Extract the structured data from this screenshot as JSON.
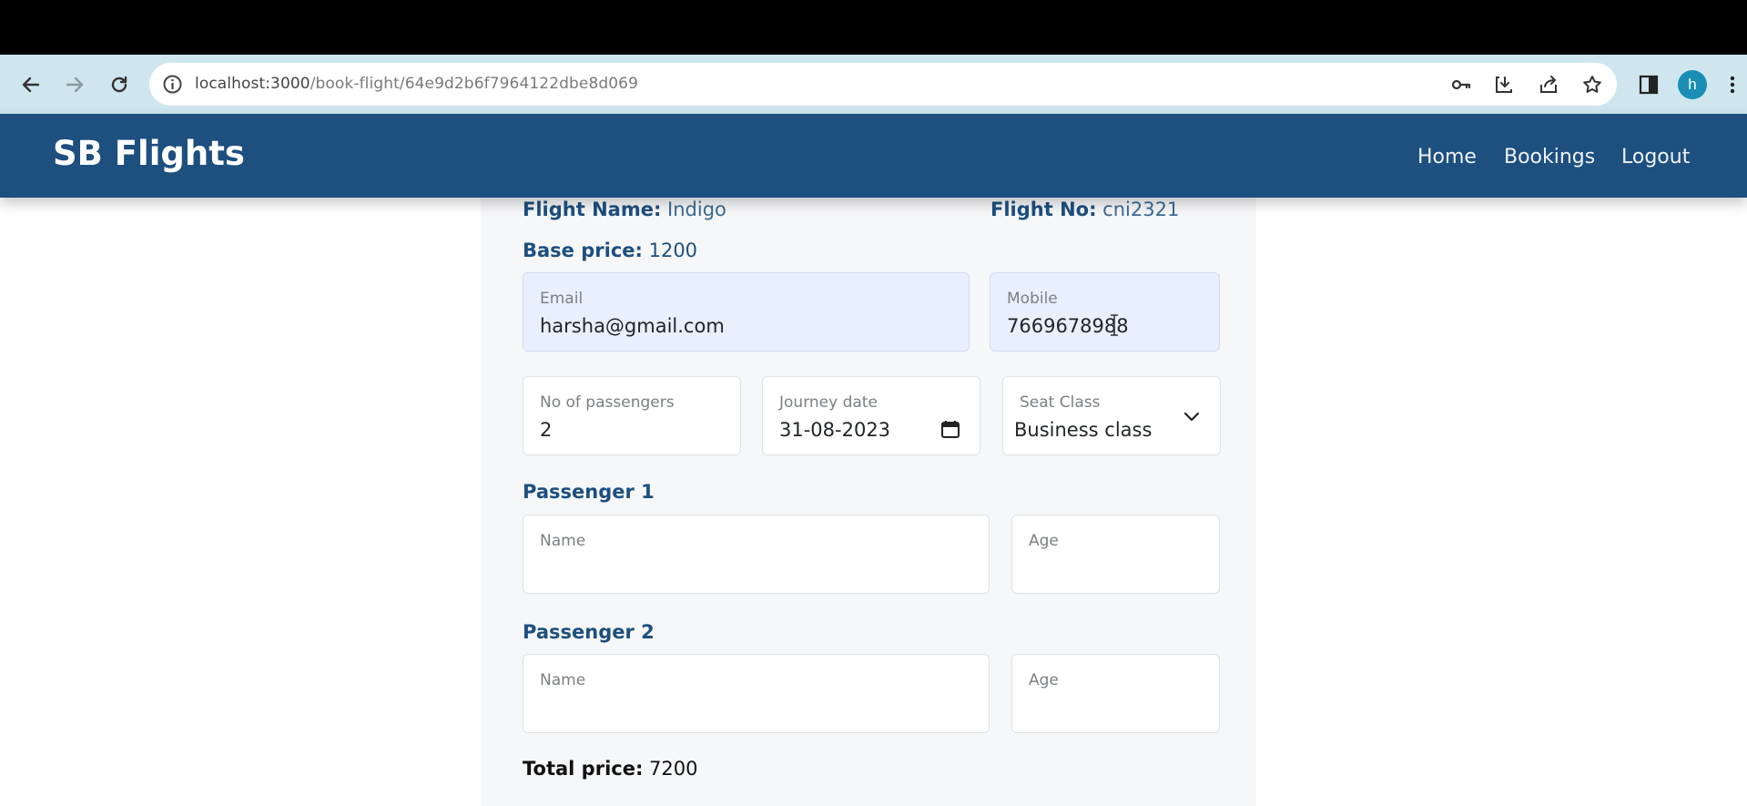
{
  "browser": {
    "url_host": "localhost:3000",
    "url_path": "/book-flight/64e9d2b6f7964122dbe8d069",
    "profile_initial": "h",
    "icons": [
      "back-arrow-icon",
      "forward-arrow-icon",
      "reload-icon",
      "info-icon",
      "key-icon",
      "install-icon",
      "share-icon",
      "star-icon",
      "side-panel-icon",
      "kebab-menu-icon"
    ]
  },
  "navbar": {
    "brand": "SB Flights",
    "links": [
      "Home",
      "Bookings",
      "Logout"
    ]
  },
  "flight": {
    "name_label": "Flight Name:",
    "name_value": "Indigo",
    "no_label": "Flight No:",
    "no_value": "cni2321",
    "base_price_label": "Base price:",
    "base_price_value": "1200"
  },
  "form": {
    "email": {
      "label": "Email",
      "value": "harsha@gmail.com"
    },
    "mobile": {
      "label": "Mobile",
      "value": "7669678988"
    },
    "passengers": {
      "label": "No of passengers",
      "value": "2"
    },
    "journey_date": {
      "label": "Journey date",
      "value": "31-08-2023"
    },
    "seat_class": {
      "label": "Seat Class",
      "value": "Business class"
    }
  },
  "passenger_list": [
    {
      "title": "Passenger 1",
      "name_label": "Name",
      "age_label": "Age"
    },
    {
      "title": "Passenger 2",
      "name_label": "Name",
      "age_label": "Age"
    }
  ],
  "total": {
    "label": "Total price:",
    "value": "7200"
  },
  "colors": {
    "navbar": "#1d4f7f",
    "chrome": "#cfe6ee",
    "autofill": "#e8f0fe"
  }
}
